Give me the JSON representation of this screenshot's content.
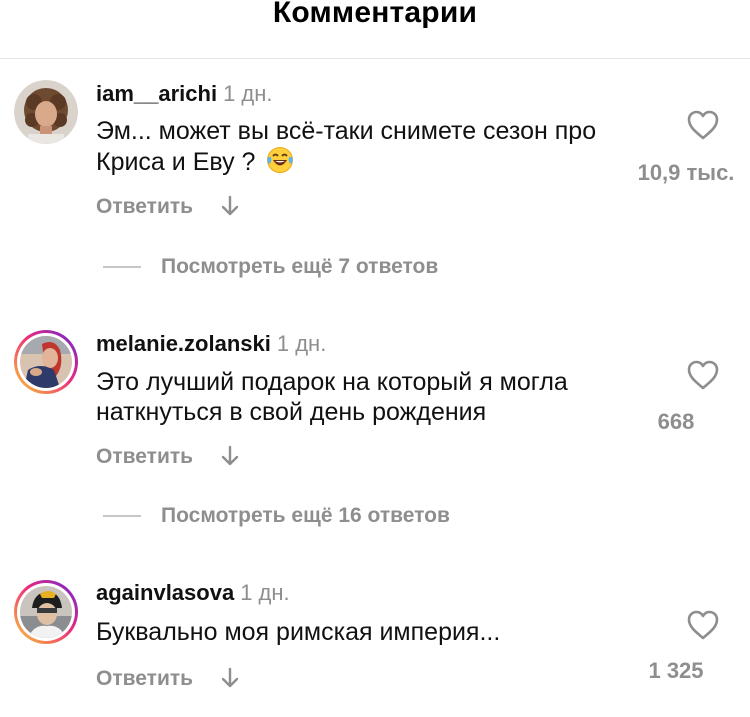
{
  "header": {
    "title": "Комментарии"
  },
  "comments": [
    {
      "username": "iam__arichi",
      "time": "1 дн.",
      "text": "Эм... может вы всё-таки снимете сезон про Криса и Еву ?",
      "emoji": "laughing-tears-emoji",
      "reply_label": "Ответить",
      "like_count": "10,9 тыс.",
      "view_replies": "Посмотреть ещё 7 ответов",
      "has_story_ring": false
    },
    {
      "username": "melanie.zolanski",
      "time": "1 дн.",
      "text": "Это лучший подарок на который я могла наткнуться в свой день рождения",
      "reply_label": "Ответить",
      "like_count": "668",
      "view_replies": "Посмотреть ещё 16 ответов",
      "has_story_ring": true
    },
    {
      "username": "againvlasova",
      "time": "1 дн.",
      "text": "Буквально моя римская империя...",
      "reply_label": "Ответить",
      "like_count": "1 325",
      "has_story_ring": true
    }
  ],
  "icons": {
    "like": "heart-outline-icon",
    "reply_arrow": "arrow-down-icon"
  },
  "colors": {
    "text": "#111111",
    "secondary": "#8e8e8e",
    "story_ring_start": "#f9ce34",
    "story_ring_mid": "#ee2a7b",
    "story_ring_end": "#6228d7"
  }
}
